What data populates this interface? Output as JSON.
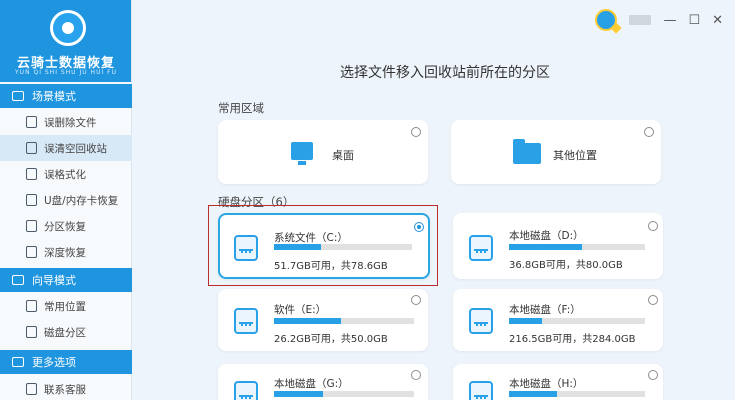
{
  "app": {
    "logo_title": "云骑士数据恢复",
    "logo_subtitle": "YUN QI SHI SHU JU HUI FU"
  },
  "sidebar": {
    "sections": [
      {
        "label": "场景模式",
        "icon": "scene-icon"
      },
      {
        "label": "向导模式",
        "icon": "guide-icon"
      },
      {
        "label": "更多选项",
        "icon": "menu-icon"
      }
    ],
    "items": [
      {
        "label": "误删除文件",
        "icon": "file-delete-icon"
      },
      {
        "label": "误清空回收站",
        "icon": "recycle-bin-icon",
        "active": true
      },
      {
        "label": "误格式化",
        "icon": "format-icon"
      },
      {
        "label": "U盘/内存卡恢复",
        "icon": "usb-icon"
      },
      {
        "label": "分区恢复",
        "icon": "partition-icon"
      },
      {
        "label": "深度恢复",
        "icon": "deep-recover-icon"
      },
      {
        "label": "常用位置",
        "icon": "location-icon"
      },
      {
        "label": "磁盘分区",
        "icon": "disk-partition-icon"
      },
      {
        "label": "联系客服",
        "icon": "support-icon"
      }
    ]
  },
  "titlebar": {
    "minimize": "—",
    "maximize": "☐",
    "close": "✕"
  },
  "main": {
    "title": "选择文件移入回收站前所在的分区",
    "common_label": "常用区域",
    "common_areas": [
      {
        "label": "桌面",
        "icon": "desktop-icon"
      },
      {
        "label": "其他位置",
        "icon": "folder-icon"
      }
    ],
    "disk_label": "硬盘分区（6）",
    "disks": [
      {
        "name": "系统文件（C:）",
        "capacity": "51.7GB可用，共78.6GB",
        "used_ratio": 0.34,
        "selected": true
      },
      {
        "name": "本地磁盘（D:）",
        "capacity": "36.8GB可用，共80.0GB",
        "used_ratio": 0.54,
        "selected": false
      },
      {
        "name": "软件（E:）",
        "capacity": "26.2GB可用，共50.0GB",
        "used_ratio": 0.48,
        "selected": false
      },
      {
        "name": "本地磁盘（F:）",
        "capacity": "216.5GB可用，共284.0GB",
        "used_ratio": 0.24,
        "selected": false
      },
      {
        "name": "本地磁盘（G:）",
        "capacity": "",
        "used_ratio": 0.35,
        "selected": false
      },
      {
        "name": "本地磁盘（H:）",
        "capacity": "",
        "used_ratio": 0.35,
        "selected": false
      }
    ]
  },
  "colors": {
    "accent": "#1f95e0",
    "bar_fill": "#27a0e6",
    "highlight": "#b92d2d"
  }
}
